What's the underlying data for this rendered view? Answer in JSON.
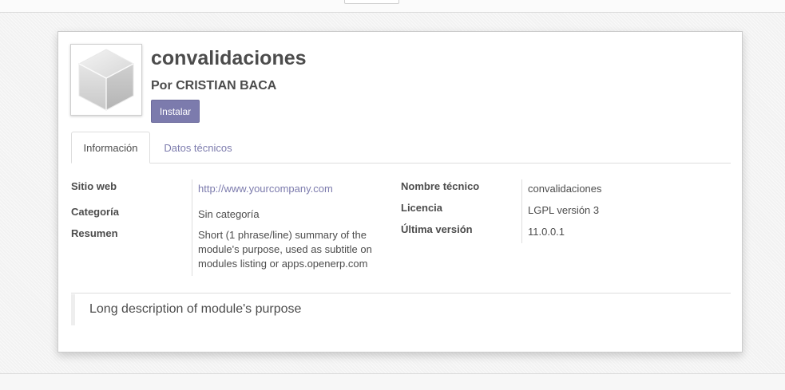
{
  "module": {
    "name": "convalidaciones",
    "author": "Por CRISTIAN BACA",
    "install_label": "Instalar"
  },
  "tabs": [
    {
      "label": "Información",
      "active": true
    },
    {
      "label": "Datos técnicos",
      "active": false
    }
  ],
  "info_left": [
    {
      "label": "Sitio web",
      "value": "http://www.yourcompany.com"
    },
    {
      "label": "Categoría",
      "value": "Sin categoría"
    },
    {
      "label": "Resumen",
      "value": "Short (1 phrase/line) summary of the module's purpose, used as subtitle on modules listing or apps.openerp.com"
    }
  ],
  "info_right": [
    {
      "label": "Nombre técnico",
      "value": "convalidaciones"
    },
    {
      "label": "Licencia",
      "value": "LGPL versión 3"
    },
    {
      "label": "Última versión",
      "value": "11.0.0.1"
    }
  ],
  "description": "Long description of module's purpose",
  "icons": {
    "module_icon": "cube-icon"
  },
  "colors": {
    "primary": "#7c7bad",
    "text": "#4c4c4c"
  }
}
